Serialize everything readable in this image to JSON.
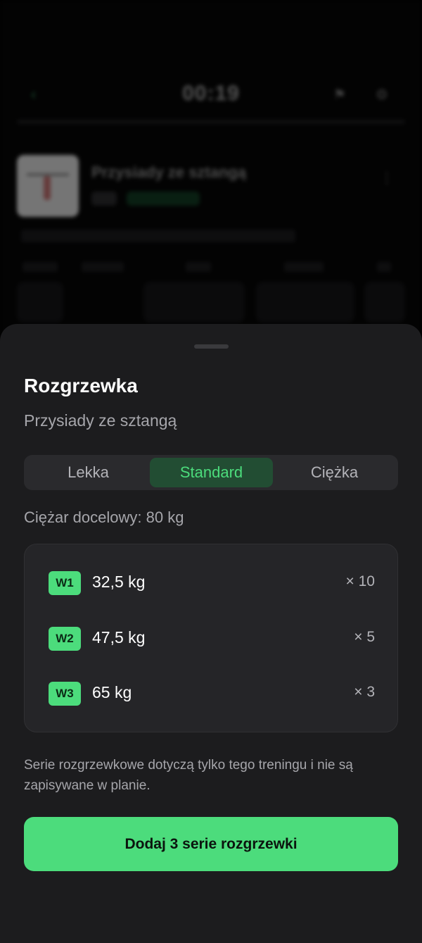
{
  "background": {
    "timer": "00:19",
    "exercise_title": "Przysiady ze sztangą"
  },
  "sheet": {
    "title": "Rozgrzewka",
    "subtitle": "Przysiady ze sztangą",
    "tabs": [
      {
        "label": "Lekka",
        "selected": false
      },
      {
        "label": "Standard",
        "selected": true
      },
      {
        "label": "Ciężka",
        "selected": false
      }
    ],
    "target_weight": "Ciężar docelowy: 80 kg",
    "sets": [
      {
        "badge": "W1",
        "weight": "32,5 kg",
        "reps": "× 10"
      },
      {
        "badge": "W2",
        "weight": "47,5 kg",
        "reps": "× 5"
      },
      {
        "badge": "W3",
        "weight": "65 kg",
        "reps": "× 3"
      }
    ],
    "info": "Serie rozgrzewkowe dotyczą tylko tego treningu i nie są zapisywane w planie.",
    "primary_button": "Dodaj 3 serie rozgrzewki"
  },
  "colors": {
    "accent": "#4cdc7c",
    "sheet_bg": "#1c1c1e",
    "card_bg": "#252528"
  }
}
